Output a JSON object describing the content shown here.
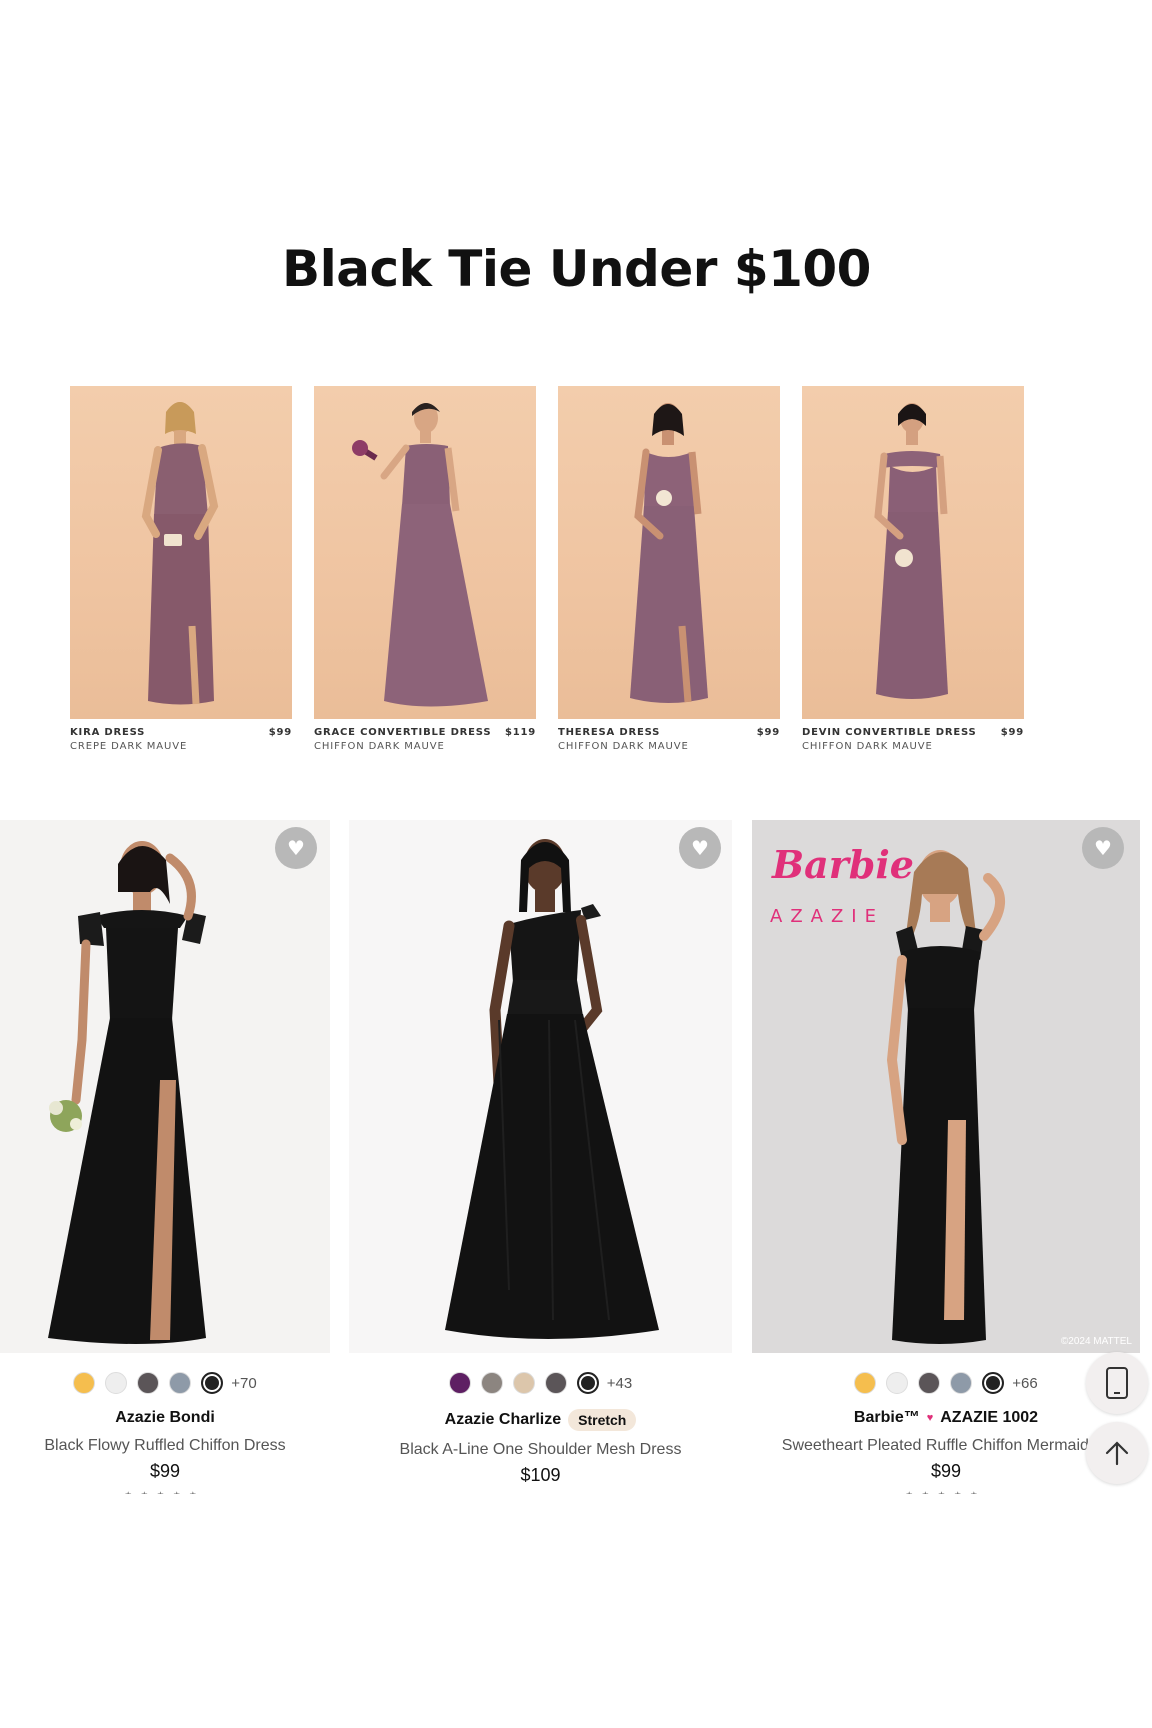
{
  "heading": "Black Tie Under $100",
  "top_row": [
    {
      "name": "KIRA DRESS",
      "price": "$99",
      "subtitle": "CREPE DARK MAUVE"
    },
    {
      "name": "GRACE CONVERTIBLE DRESS",
      "price": "$119",
      "subtitle": "CHIFFON DARK MAUVE"
    },
    {
      "name": "THERESA DRESS",
      "price": "$99",
      "subtitle": "CHIFFON DARK MAUVE"
    },
    {
      "name": "DEVIN CONVERTIBLE DRESS",
      "price": "$99",
      "subtitle": "CHIFFON DARK MAUVE"
    }
  ],
  "products": [
    {
      "brand": "Azazie Bondi",
      "description": "Black Flowy Ruffled Chiffon Dress",
      "price": "$99",
      "more_colors": "+70",
      "swatches": [
        "#f5be4e",
        "#eeeeee",
        "#5b5558",
        "#8e9aa8",
        "#222222"
      ],
      "rating_stars": "★★★★★"
    },
    {
      "brand": "Azazie Charlize",
      "tag": "Stretch",
      "description": "Black A-Line One Shoulder Mesh Dress",
      "price": "$109",
      "more_colors": "+43",
      "swatches": [
        "#5e1f63",
        "#8c8580",
        "#dcc6ab",
        "#5b5558",
        "#222222"
      ],
      "rating_stars": "★★★★★"
    },
    {
      "brand_prefix": "Barbie™",
      "brand": "AZAZIE 1002",
      "description": "Sweetheart Pleated Ruffle Chiffon Mermaid Dr",
      "price": "$99",
      "more_colors": "+66",
      "swatches": [
        "#f5be4e",
        "#eeeeee",
        "#5b5558",
        "#8e9aa8",
        "#222222"
      ],
      "rating_stars": "★★★★★",
      "logo_script": "Barbie",
      "logo_word": "AZAZIE",
      "copyright": "©2024 MATTEL"
    }
  ],
  "icons": {
    "wishlist": "heart-icon",
    "app": "phone-icon",
    "back_to_top": "arrow-up-icon"
  },
  "colors": {
    "mauve_bg": "#efc4a1",
    "mauve_dress": "#8a5f70",
    "black_dress": "#141414",
    "barbie_pink": "#e0307a"
  }
}
